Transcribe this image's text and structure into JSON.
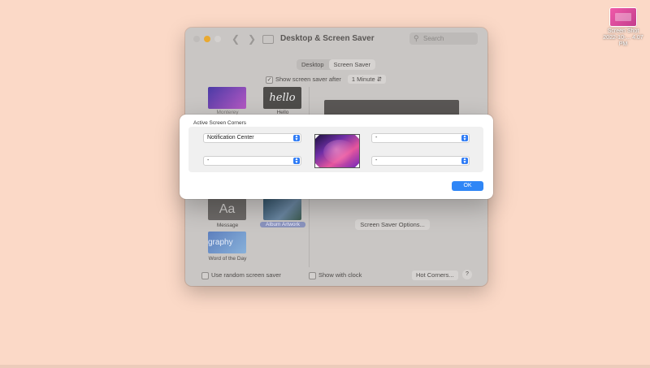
{
  "desktop": {
    "file_icon_label_line1": "Screen Shot",
    "file_icon_label_line2": "2022-10-... 4.07 PM"
  },
  "window": {
    "title": "Desktop & Screen Saver",
    "search_placeholder": "Search",
    "tabs": [
      {
        "label": "Desktop",
        "selected": false
      },
      {
        "label": "Screen Saver",
        "selected": true
      }
    ],
    "show_after_label": "Show screen saver after",
    "show_after_checked": true,
    "show_after_value": "1 Minute",
    "savers": [
      {
        "label": "Monterey"
      },
      {
        "label": "Hello",
        "thumb_text": "hello"
      },
      {
        "label": "Message",
        "thumb_text": "Aa"
      },
      {
        "label": "Album Artwork",
        "selected": true
      },
      {
        "label": "Word of the Day",
        "thumb_text": "graphy"
      }
    ],
    "screen_saver_options_label": "Screen Saver Options...",
    "use_random_label": "Use random screen saver",
    "show_clock_label": "Show with clock",
    "hot_corners_label": "Hot Corners...",
    "help_label": "?"
  },
  "sheet": {
    "title": "Active Screen Corners",
    "top_left": "Notification Center",
    "top_right": "-",
    "bottom_left": "-",
    "bottom_right": "-",
    "ok_label": "OK"
  },
  "colors": {
    "desktop_bg": "#fbd9c7",
    "accent": "#2f86f6"
  }
}
